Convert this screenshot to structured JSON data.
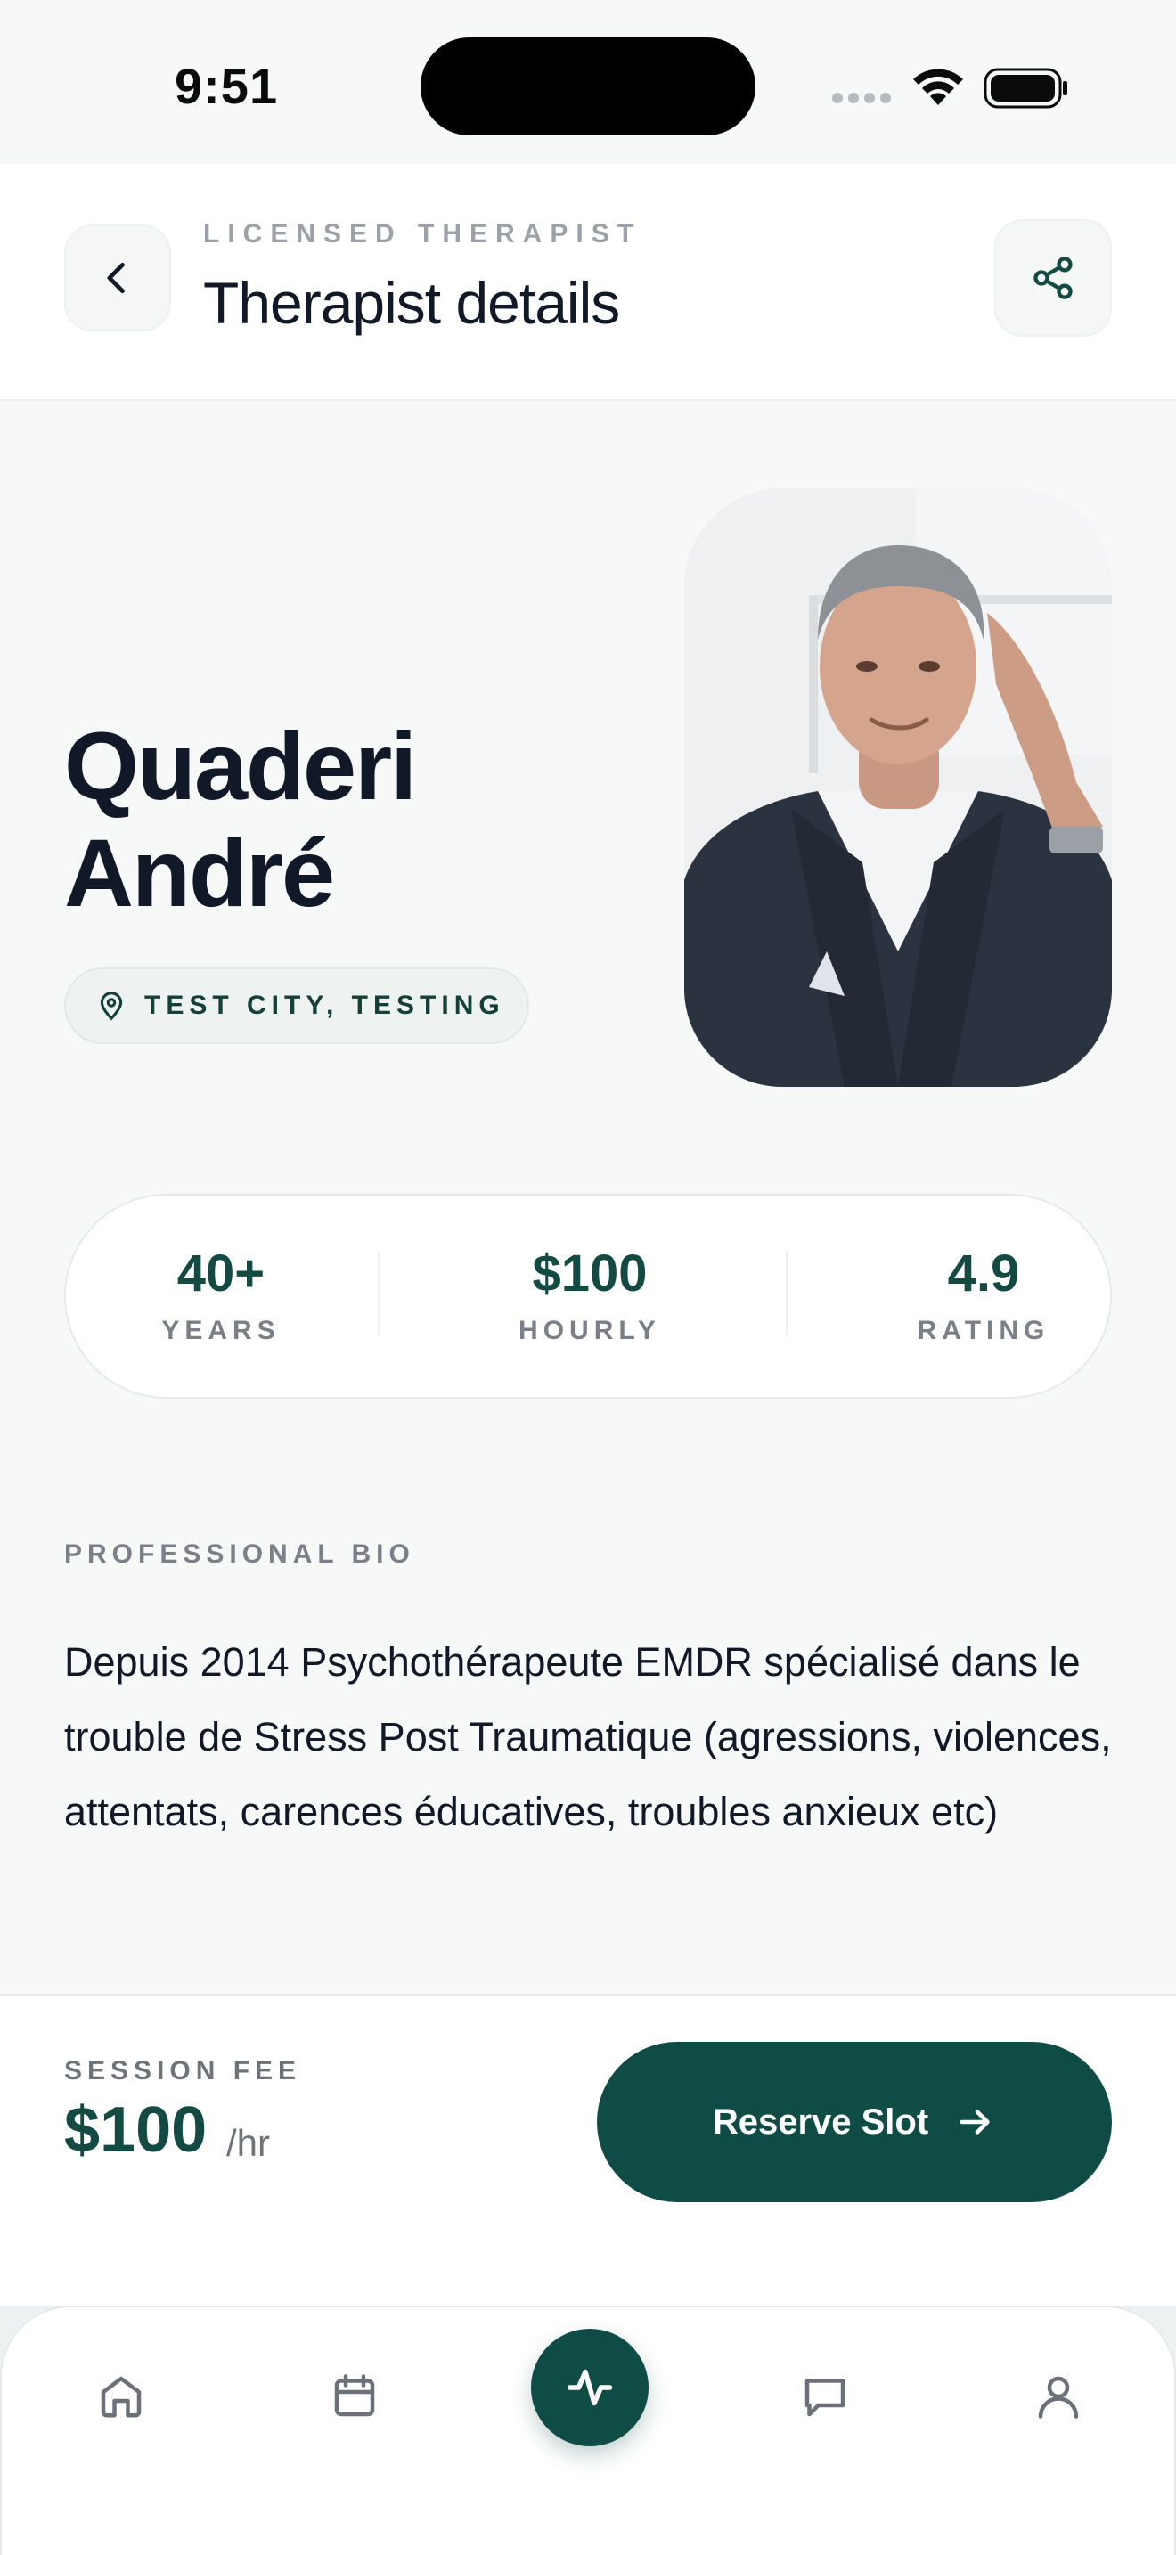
{
  "status_bar": {
    "time": "9:51"
  },
  "header": {
    "eyebrow": "LICENSED THERAPIST",
    "title": "Therapist details"
  },
  "therapist": {
    "first_name": "Quaderi",
    "last_name": "André",
    "location": "TEST CITY, TESTING"
  },
  "stats": [
    {
      "value": "40+",
      "label": "YEARS"
    },
    {
      "value": "$100",
      "label": "HOURLY"
    },
    {
      "value": "4.9",
      "label": "RATING"
    }
  ],
  "bio": {
    "label": "PROFESSIONAL BIO",
    "text": "Depuis 2014 Psychothérapeute EMDR spécialisé dans le trouble de Stress Post Traumatique (agressions, violences, attentats, carences éducatives, troubles anxieux etc)"
  },
  "booking": {
    "fee_label": "SESSION FEE",
    "fee_amount": "$100",
    "fee_unit": "/hr",
    "reserve_label": "Reserve Slot"
  },
  "colors": {
    "brand": "#0f4c45",
    "text": "#111827",
    "muted": "#7b8088"
  },
  "tabs": [
    {
      "icon": "home-icon"
    },
    {
      "icon": "calendar-icon"
    },
    {
      "icon": "activity-icon"
    },
    {
      "icon": "chat-icon"
    },
    {
      "icon": "profile-icon"
    }
  ]
}
